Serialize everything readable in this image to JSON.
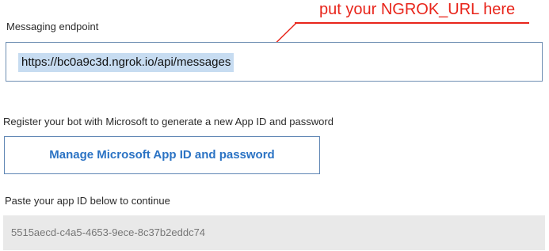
{
  "annotation": {
    "text": "put your NGROK_URL here",
    "color": "#e8251b"
  },
  "endpoint": {
    "label": "Messaging endpoint",
    "value": "https://bc0a9c3d.ngrok.io/api/messages",
    "selection_color": "#c7dcf1"
  },
  "register": {
    "text": "Register your bot with Microsoft to generate a new App ID and password",
    "button_label": "Manage Microsoft App ID and password",
    "button_color": "#2b73c4"
  },
  "app_id": {
    "label": "Paste your app ID below to continue",
    "value": "5515aecd-c4a5-4653-9ece-8c37b2eddc74"
  }
}
